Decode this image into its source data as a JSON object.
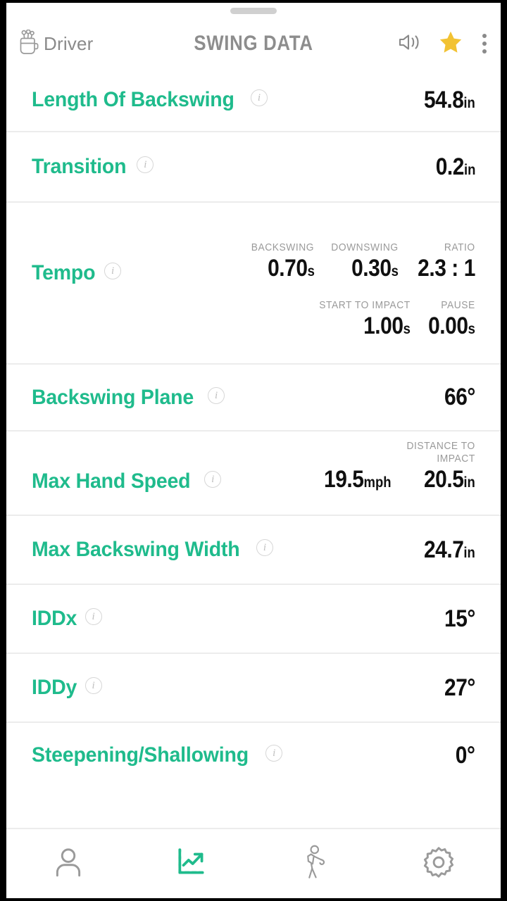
{
  "app": {
    "title": "SWING DATA",
    "club": "Driver",
    "accent_color": "#1fbb8c",
    "value_color": "#101010",
    "muted_color": "#9a9a9a",
    "star_color": "#f2c233"
  },
  "header": {
    "club_icon": "golf-bag-icon",
    "sound_icon": "speaker-icon",
    "favorite_icon": "star-icon",
    "overflow_icon": "more-vertical-icon",
    "drag_handle": "drag-handle"
  },
  "metrics": [
    {
      "label": "Length Of Backswing",
      "info": "i",
      "values": [
        {
          "header": "",
          "number": "54.8",
          "unit": "in"
        }
      ]
    },
    {
      "label": "Transition",
      "info": "i",
      "values": [
        {
          "header": "",
          "number": "0.2",
          "unit": "in"
        }
      ]
    },
    {
      "label": "Tempo",
      "info": "i",
      "groups": [
        [
          {
            "header": "BACKSWING",
            "number": "0.70",
            "unit": "s"
          },
          {
            "header": "DOWNSWING",
            "number": "0.30",
            "unit": "s"
          },
          {
            "header": "RATIO",
            "number": "2.3 : 1",
            "unit": ""
          }
        ],
        [
          {
            "header": "START TO IMPACT",
            "number": "1.00",
            "unit": "s"
          },
          {
            "header": "PAUSE",
            "number": "0.00",
            "unit": "s"
          }
        ]
      ]
    },
    {
      "label": "Backswing Plane",
      "info": "i",
      "values": [
        {
          "header": "",
          "number": "66°",
          "unit": ""
        }
      ]
    },
    {
      "label": "Max Hand Speed",
      "info": "i",
      "values": [
        {
          "header": "",
          "number": "19.5",
          "unit": "mph"
        },
        {
          "header": "DISTANCE TO\nIMPACT",
          "number": "20.5",
          "unit": "in"
        }
      ]
    },
    {
      "label": "Max Backswing Width",
      "info": "i",
      "values": [
        {
          "header": "",
          "number": "24.7",
          "unit": "in"
        }
      ]
    },
    {
      "label": "IDDx",
      "info": "i",
      "values": [
        {
          "header": "",
          "number": "15°",
          "unit": ""
        }
      ]
    },
    {
      "label": "IDDy",
      "info": "i",
      "values": [
        {
          "header": "",
          "number": "27°",
          "unit": ""
        }
      ]
    },
    {
      "label": "Steepening/Shallowing",
      "info": "i",
      "values": [
        {
          "header": "",
          "number": "0°",
          "unit": ""
        }
      ]
    }
  ],
  "nav": [
    {
      "name": "profile",
      "icon": "person-icon",
      "active": false
    },
    {
      "name": "stats",
      "icon": "chart-trending-icon",
      "active": true
    },
    {
      "name": "swing",
      "icon": "golfer-icon",
      "active": false
    },
    {
      "name": "settings",
      "icon": "gear-icon",
      "active": false
    }
  ]
}
